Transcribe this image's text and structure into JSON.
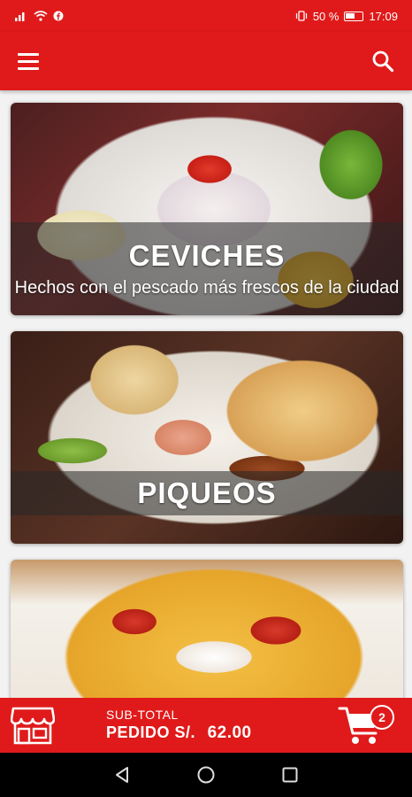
{
  "status_bar": {
    "signal_text": "",
    "battery_percent": "50 %",
    "time": "17:09"
  },
  "app_bar": {
    "menu_icon": "hamburger-menu-icon",
    "search_icon": "search-icon",
    "accent_color": "#e01a1a"
  },
  "categories": [
    {
      "title": "CEVICHES",
      "subtitle": "Hechos con el pescado más frescos de la ciudad"
    },
    {
      "title": "PIQUEOS",
      "subtitle": ""
    },
    {
      "title": "",
      "subtitle": ""
    }
  ],
  "cart": {
    "subtotal_label": "SUB-TOTAL",
    "order_label": "PEDIDO",
    "currency": "S/.",
    "amount": "62.00",
    "item_count": "2",
    "store_icon": "storefront-icon",
    "cart_icon": "shopping-cart-icon"
  },
  "nav": {
    "back_icon": "back-triangle-icon",
    "home_icon": "home-circle-icon",
    "recents_icon": "recents-square-icon"
  }
}
